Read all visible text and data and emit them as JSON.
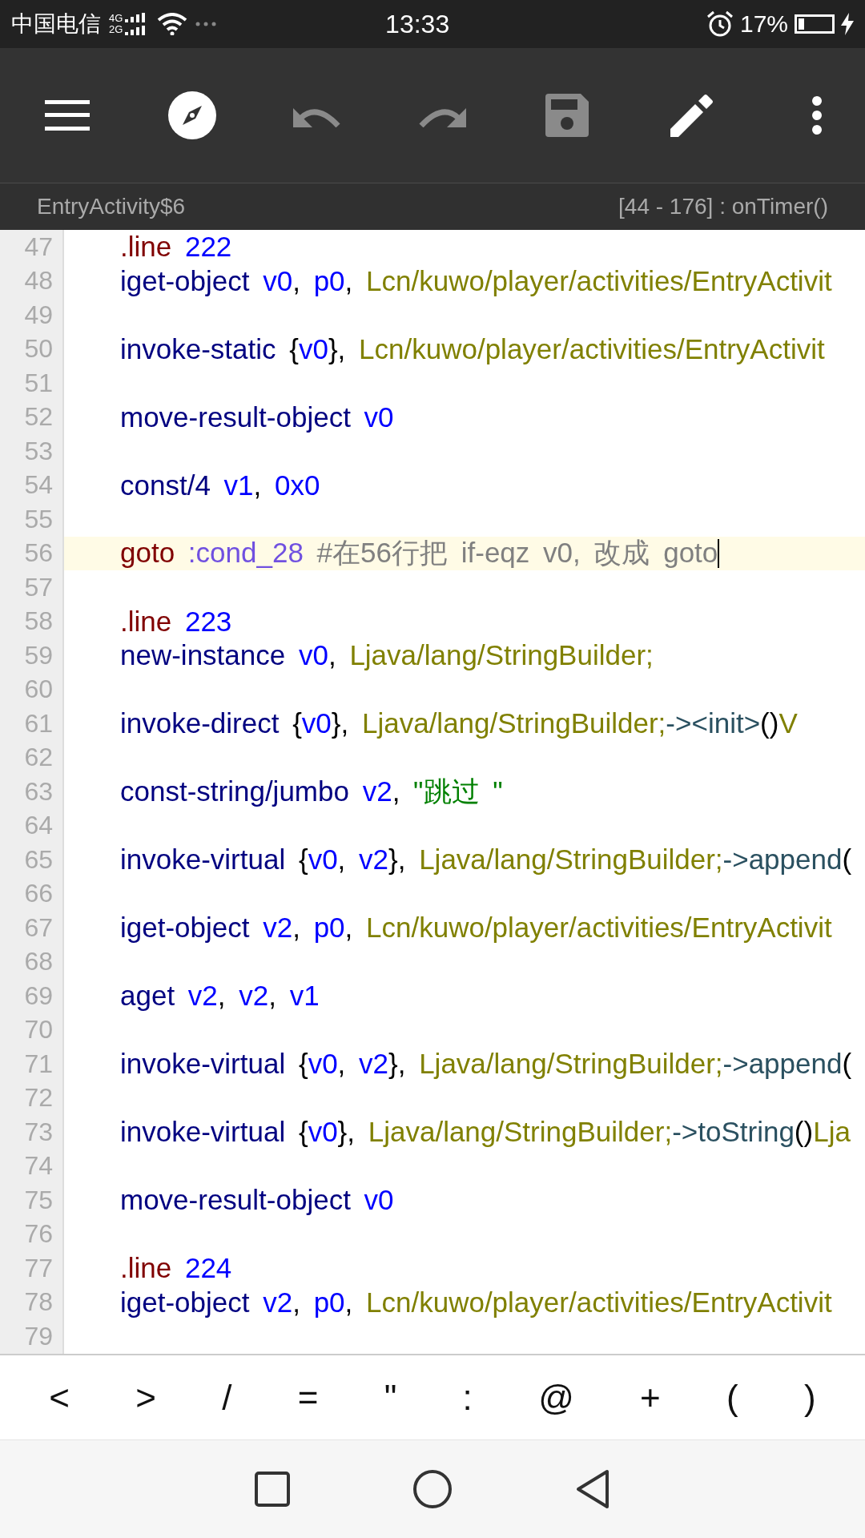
{
  "status_bar": {
    "carrier": "中国电信",
    "network_types": [
      "4G",
      "2G"
    ],
    "time": "13:33",
    "battery_percent": "17%",
    "battery": {
      "level": 0.17
    },
    "charging": true
  },
  "toolbar": {
    "items": [
      {
        "kind": "menu",
        "disabled": false
      },
      {
        "kind": "navigate",
        "disabled": false
      },
      {
        "kind": "undo",
        "disabled": true
      },
      {
        "kind": "redo",
        "disabled": true
      },
      {
        "kind": "save",
        "disabled": true
      },
      {
        "kind": "edit",
        "disabled": false
      },
      {
        "kind": "more",
        "disabled": false
      }
    ]
  },
  "subtitle": {
    "class_name": "EntryActivity$6",
    "method_range": "[44 - 176] : onTimer()"
  },
  "editor": {
    "lines": [
      {
        "number": "47",
        "current": false,
        "tokens": [
          {
            "kind": "directive",
            "text": ".line "
          },
          {
            "kind": "register",
            "text": "222"
          }
        ]
      },
      {
        "number": "48",
        "current": false,
        "tokens": [
          {
            "kind": "opcode",
            "text": "iget-object "
          },
          {
            "kind": "register",
            "text": "v0"
          },
          {
            "kind": "punct",
            "text": ", "
          },
          {
            "kind": "register",
            "text": "p0"
          },
          {
            "kind": "punct",
            "text": ", "
          },
          {
            "kind": "type",
            "text": "Lcn/kuwo/player/activities/EntryActivit"
          }
        ]
      },
      {
        "number": "49",
        "current": false
      },
      {
        "number": "50",
        "current": false,
        "tokens": [
          {
            "kind": "opcode",
            "text": "invoke-static "
          },
          {
            "kind": "punct",
            "text": "{"
          },
          {
            "kind": "register",
            "text": "v0"
          },
          {
            "kind": "punct",
            "text": "}, "
          },
          {
            "kind": "type",
            "text": "Lcn/kuwo/player/activities/EntryActivit"
          }
        ]
      },
      {
        "number": "51",
        "current": false
      },
      {
        "number": "52",
        "current": false,
        "tokens": [
          {
            "kind": "opcode",
            "text": "move-result-object "
          },
          {
            "kind": "register",
            "text": "v0"
          }
        ]
      },
      {
        "number": "53",
        "current": false
      },
      {
        "number": "54",
        "current": false,
        "tokens": [
          {
            "kind": "opcode",
            "text": "const/4 "
          },
          {
            "kind": "register",
            "text": "v1"
          },
          {
            "kind": "punct",
            "text": ", "
          },
          {
            "kind": "register",
            "text": "0x0"
          }
        ]
      },
      {
        "number": "55",
        "current": false
      },
      {
        "number": "56",
        "current": true,
        "tokens": [
          {
            "kind": "directive",
            "text": "goto "
          },
          {
            "kind": "label",
            "text": ":cond_28 "
          },
          {
            "kind": "comment",
            "text": "#在56行把 if-eqz v0, 改成 goto"
          }
        ]
      },
      {
        "number": "57",
        "current": false
      },
      {
        "number": "58",
        "current": false,
        "tokens": [
          {
            "kind": "directive",
            "text": ".line "
          },
          {
            "kind": "register",
            "text": "223"
          }
        ]
      },
      {
        "number": "59",
        "current": false,
        "tokens": [
          {
            "kind": "opcode",
            "text": "new-instance "
          },
          {
            "kind": "register",
            "text": "v0"
          },
          {
            "kind": "punct",
            "text": ", "
          },
          {
            "kind": "type",
            "text": "Ljava/lang/StringBuilder;"
          }
        ]
      },
      {
        "number": "60",
        "current": false
      },
      {
        "number": "61",
        "current": false,
        "tokens": [
          {
            "kind": "opcode",
            "text": "invoke-direct "
          },
          {
            "kind": "punct",
            "text": "{"
          },
          {
            "kind": "register",
            "text": "v0"
          },
          {
            "kind": "punct",
            "text": "}, "
          },
          {
            "kind": "type",
            "text": "Ljava/lang/StringBuilder;"
          },
          {
            "kind": "method",
            "text": "-><init>"
          },
          {
            "kind": "punct",
            "text": "()"
          },
          {
            "kind": "type",
            "text": "V"
          }
        ]
      },
      {
        "number": "62",
        "current": false
      },
      {
        "number": "63",
        "current": false,
        "tokens": [
          {
            "kind": "opcode",
            "text": "const-string/jumbo "
          },
          {
            "kind": "register",
            "text": "v2"
          },
          {
            "kind": "punct",
            "text": ", "
          },
          {
            "kind": "string",
            "text": "\"跳过 \""
          }
        ]
      },
      {
        "number": "64",
        "current": false
      },
      {
        "number": "65",
        "current": false,
        "tokens": [
          {
            "kind": "opcode",
            "text": "invoke-virtual "
          },
          {
            "kind": "punct",
            "text": "{"
          },
          {
            "kind": "register",
            "text": "v0"
          },
          {
            "kind": "punct",
            "text": ", "
          },
          {
            "kind": "register",
            "text": "v2"
          },
          {
            "kind": "punct",
            "text": "}, "
          },
          {
            "kind": "type",
            "text": "Ljava/lang/StringBuilder;"
          },
          {
            "kind": "method",
            "text": "->append"
          },
          {
            "kind": "punct",
            "text": "("
          }
        ]
      },
      {
        "number": "66",
        "current": false
      },
      {
        "number": "67",
        "current": false,
        "tokens": [
          {
            "kind": "opcode",
            "text": "iget-object "
          },
          {
            "kind": "register",
            "text": "v2"
          },
          {
            "kind": "punct",
            "text": ", "
          },
          {
            "kind": "register",
            "text": "p0"
          },
          {
            "kind": "punct",
            "text": ", "
          },
          {
            "kind": "type",
            "text": "Lcn/kuwo/player/activities/EntryActivit"
          }
        ]
      },
      {
        "number": "68",
        "current": false
      },
      {
        "number": "69",
        "current": false,
        "tokens": [
          {
            "kind": "opcode",
            "text": "aget "
          },
          {
            "kind": "register",
            "text": "v2"
          },
          {
            "kind": "punct",
            "text": ", "
          },
          {
            "kind": "register",
            "text": "v2"
          },
          {
            "kind": "punct",
            "text": ", "
          },
          {
            "kind": "register",
            "text": "v1"
          }
        ]
      },
      {
        "number": "70",
        "current": false
      },
      {
        "number": "71",
        "current": false,
        "tokens": [
          {
            "kind": "opcode",
            "text": "invoke-virtual "
          },
          {
            "kind": "punct",
            "text": "{"
          },
          {
            "kind": "register",
            "text": "v0"
          },
          {
            "kind": "punct",
            "text": ", "
          },
          {
            "kind": "register",
            "text": "v2"
          },
          {
            "kind": "punct",
            "text": "}, "
          },
          {
            "kind": "type",
            "text": "Ljava/lang/StringBuilder;"
          },
          {
            "kind": "method",
            "text": "->append"
          },
          {
            "kind": "punct",
            "text": "("
          }
        ]
      },
      {
        "number": "72",
        "current": false
      },
      {
        "number": "73",
        "current": false,
        "tokens": [
          {
            "kind": "opcode",
            "text": "invoke-virtual "
          },
          {
            "kind": "punct",
            "text": "{"
          },
          {
            "kind": "register",
            "text": "v0"
          },
          {
            "kind": "punct",
            "text": "}, "
          },
          {
            "kind": "type",
            "text": "Ljava/lang/StringBuilder;"
          },
          {
            "kind": "method",
            "text": "->toString"
          },
          {
            "kind": "punct",
            "text": "()"
          },
          {
            "kind": "type",
            "text": "Lja"
          }
        ]
      },
      {
        "number": "74",
        "current": false
      },
      {
        "number": "75",
        "current": false,
        "tokens": [
          {
            "kind": "opcode",
            "text": "move-result-object "
          },
          {
            "kind": "register",
            "text": "v0"
          }
        ]
      },
      {
        "number": "76",
        "current": false
      },
      {
        "number": "77",
        "current": false,
        "tokens": [
          {
            "kind": "directive",
            "text": ".line "
          },
          {
            "kind": "register",
            "text": "224"
          }
        ]
      },
      {
        "number": "78",
        "current": false,
        "tokens": [
          {
            "kind": "opcode",
            "text": "iget-object "
          },
          {
            "kind": "register",
            "text": "v2"
          },
          {
            "kind": "punct",
            "text": ", "
          },
          {
            "kind": "register",
            "text": "p0"
          },
          {
            "kind": "punct",
            "text": ", "
          },
          {
            "kind": "type",
            "text": "Lcn/kuwo/player/activities/EntryActivit"
          }
        ]
      },
      {
        "number": "79",
        "current": false
      }
    ]
  },
  "symbol_keys": [
    "<",
    ">",
    "/",
    "=",
    "\"",
    ":",
    "@",
    "+",
    "(",
    ")"
  ],
  "nav_bar": {
    "buttons": [
      {
        "kind": "recents"
      },
      {
        "kind": "home"
      },
      {
        "kind": "back"
      }
    ]
  }
}
